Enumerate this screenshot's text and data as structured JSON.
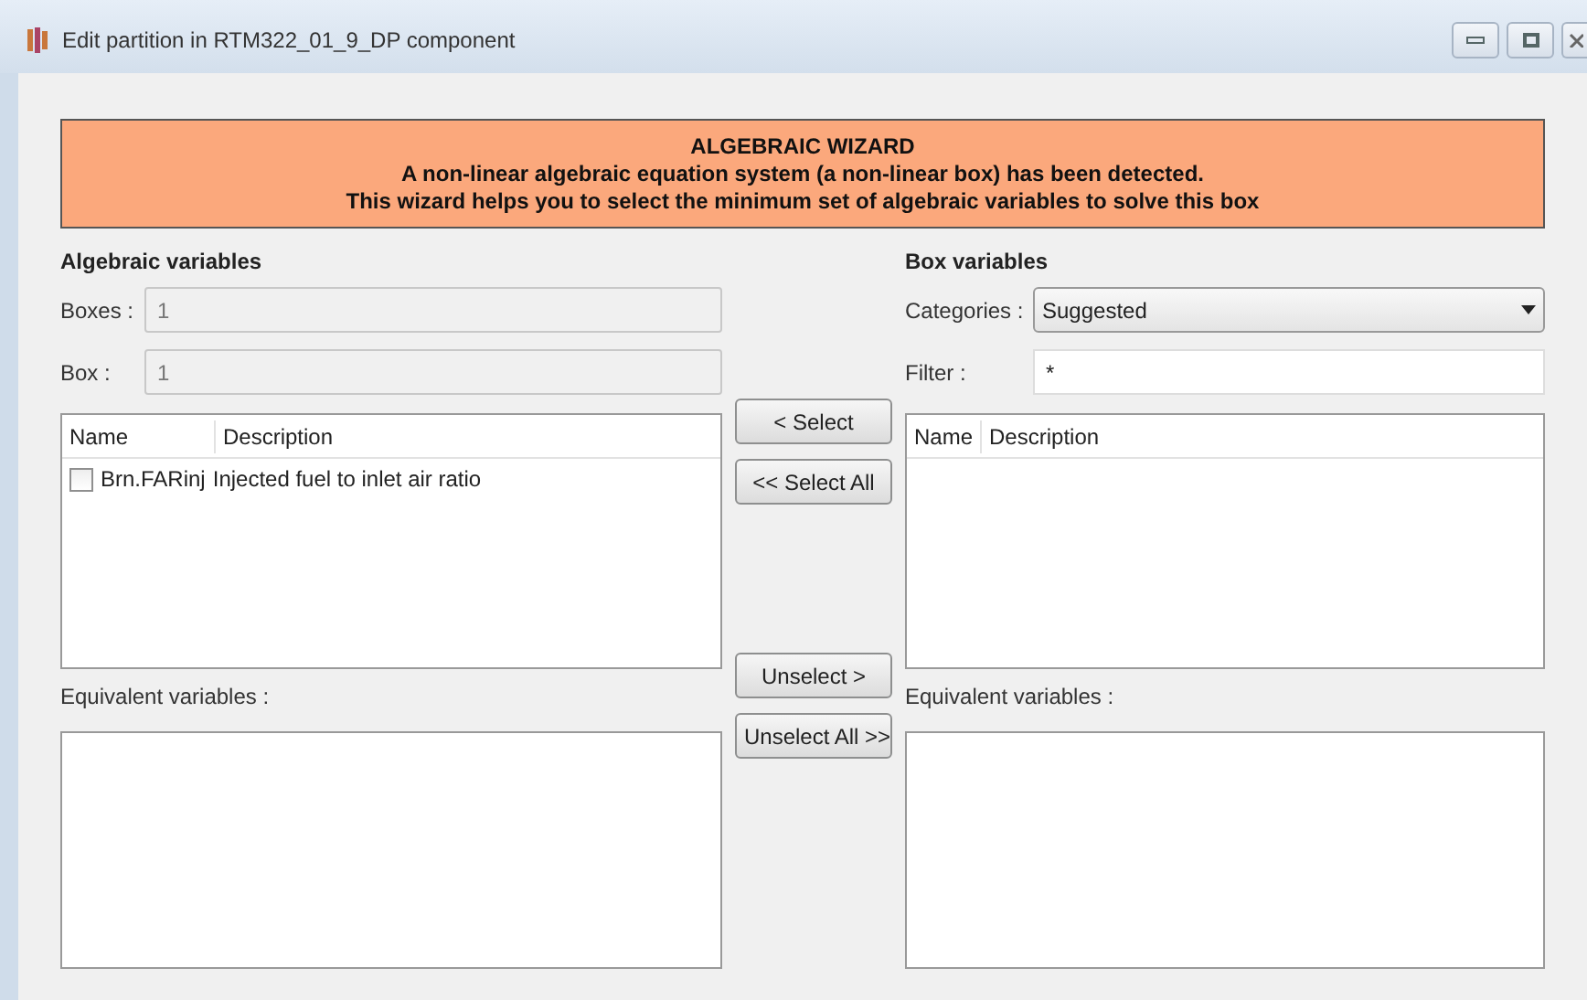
{
  "window": {
    "title": "Edit partition in RTM322_01_9_DP component"
  },
  "banner": {
    "title": "ALGEBRAIC WIZARD",
    "lines": [
      "A non-linear algebraic equation system (a non-linear box) has been detected.",
      "This wizard helps you to select the minimum set of algebraic variables to solve this box"
    ]
  },
  "algebraic": {
    "heading": "Algebraic variables",
    "fields": [
      {
        "label": "Boxes :",
        "value": "1",
        "disabled": true
      },
      {
        "label": "Box :",
        "value": "1",
        "disabled": true
      }
    ],
    "table": {
      "columns": [
        "Name",
        "Description"
      ],
      "rows": [
        {
          "name": "Brn.FARinj",
          "description": "Injected fuel to inlet air ratio",
          "checked": false
        }
      ]
    },
    "equivalent_label": "Equivalent variables :"
  },
  "buttons_top": [
    "< Select",
    "<< Select All"
  ],
  "buttons_bottom": [
    "Unselect >",
    "Unselect All >>"
  ],
  "box_vars": {
    "heading": "Box variables",
    "categories": {
      "label": "Categories :",
      "value": "Suggested"
    },
    "filter": {
      "label": "Filter :",
      "value": "*"
    },
    "table": {
      "columns": [
        "Name",
        "Description"
      ]
    },
    "equivalent_label": "Equivalent variables :"
  }
}
